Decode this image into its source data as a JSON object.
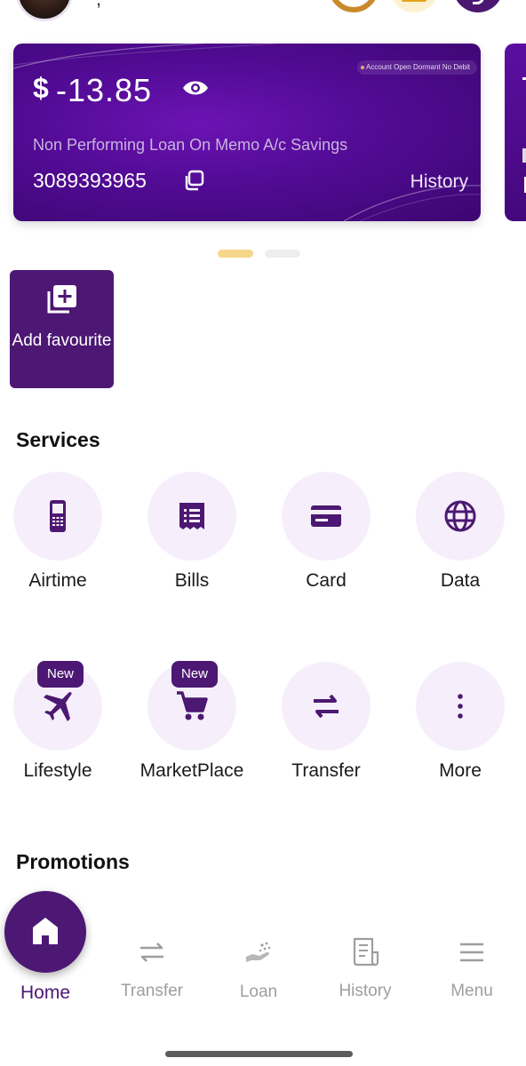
{
  "header": {
    "comma": ","
  },
  "account_card": {
    "badge": "Account Open Dormant No Debit",
    "currency": "$",
    "amount": "-13.85",
    "account_name": "Non Performing Loan On Memo A/c Savings",
    "account_number": "3089393965",
    "history_label": "History"
  },
  "carousel": {
    "pages": 2,
    "active": 1
  },
  "favourite": {
    "label": "Add favourite"
  },
  "services": {
    "title": "Services",
    "items": [
      {
        "label": "Airtime",
        "icon": "phone-icon",
        "new": ""
      },
      {
        "label": "Bills",
        "icon": "receipt-icon",
        "new": ""
      },
      {
        "label": "Card",
        "icon": "card-icon",
        "new": ""
      },
      {
        "label": "Data",
        "icon": "globe-icon",
        "new": ""
      },
      {
        "label": "Lifestyle",
        "icon": "plane-icon",
        "new": "New"
      },
      {
        "label": "MarketPlace",
        "icon": "cart-icon",
        "new": "New"
      },
      {
        "label": "Transfer",
        "icon": "transfer-arrows-icon",
        "new": ""
      },
      {
        "label": "More",
        "icon": "more-vertical-icon",
        "new": ""
      }
    ]
  },
  "promotions": {
    "title": "Promotions"
  },
  "bottom_nav": {
    "items": [
      {
        "label": "Home",
        "icon": "home-icon"
      },
      {
        "label": "Transfer",
        "icon": "transfer-icon"
      },
      {
        "label": "Loan",
        "icon": "loan-hand-icon"
      },
      {
        "label": "History",
        "icon": "receipt-history-icon"
      },
      {
        "label": "Menu",
        "icon": "hamburger-menu-icon"
      }
    ]
  },
  "colors": {
    "brand_purple": "#4c1873",
    "accent_gold": "#f6d68b",
    "service_bg": "#f6effb"
  }
}
